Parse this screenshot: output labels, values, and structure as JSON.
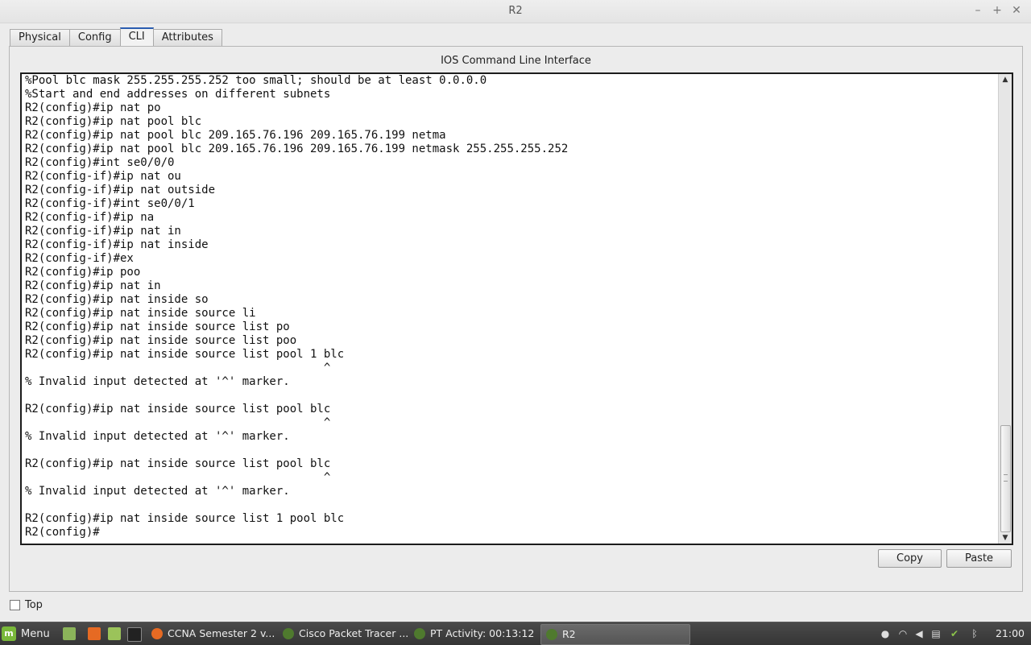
{
  "window": {
    "title": "R2",
    "controls": {
      "minimize": "–",
      "maximize": "+",
      "close": "✕"
    }
  },
  "tabs": [
    {
      "label": "Physical",
      "active": false
    },
    {
      "label": "Config",
      "active": false
    },
    {
      "label": "CLI",
      "active": true
    },
    {
      "label": "Attributes",
      "active": false
    }
  ],
  "cli": {
    "heading": "IOS Command Line Interface",
    "lines": [
      "%Pool blc mask 255.255.255.252 too small; should be at least 0.0.0.0",
      "%Start and end addresses on different subnets",
      "R2(config)#ip nat po",
      "R2(config)#ip nat pool blc",
      "R2(config)#ip nat pool blc 209.165.76.196 209.165.76.199 netma",
      "R2(config)#ip nat pool blc 209.165.76.196 209.165.76.199 netmask 255.255.255.252",
      "R2(config)#int se0/0/0",
      "R2(config-if)#ip nat ou",
      "R2(config-if)#ip nat outside",
      "R2(config-if)#int se0/0/1",
      "R2(config-if)#ip na",
      "R2(config-if)#ip nat in",
      "R2(config-if)#ip nat inside",
      "R2(config-if)#ex",
      "R2(config)#ip poo",
      "R2(config)#ip nat in",
      "R2(config)#ip nat inside so",
      "R2(config)#ip nat inside source li",
      "R2(config)#ip nat inside source list po",
      "R2(config)#ip nat inside source list poo",
      "R2(config)#ip nat inside source list pool 1 blc",
      "                                            ^",
      "% Invalid input detected at '^' marker.",
      "",
      "R2(config)#ip nat inside source list pool blc",
      "                                            ^",
      "% Invalid input detected at '^' marker.",
      "",
      "R2(config)#ip nat inside source list pool blc",
      "                                            ^",
      "% Invalid input detected at '^' marker.",
      "",
      "R2(config)#ip nat inside source list 1 pool blc",
      "R2(config)#"
    ],
    "copy_label": "Copy",
    "paste_label": "Paste"
  },
  "top_checkbox": {
    "label": "Top",
    "checked": false
  },
  "taskbar": {
    "menu_label": "Menu",
    "tasks": [
      {
        "label": "CCNA Semester 2 v...",
        "icon": "firefox-icon",
        "active": false
      },
      {
        "label": "Cisco Packet Tracer ...",
        "icon": "packet-tracer-icon",
        "active": false
      },
      {
        "label": "PT Activity: 00:13:12",
        "icon": "packet-tracer-icon",
        "active": false
      },
      {
        "label": "R2",
        "icon": "packet-tracer-icon",
        "active": true
      }
    ],
    "clock": "21:00",
    "tray_icons": [
      "user-icon",
      "wifi-icon",
      "volume-icon",
      "clipboard-icon",
      "shield-icon",
      "bluetooth-icon"
    ]
  },
  "colors": {
    "accent": "#2a5db0",
    "mint_green": "#79b83a",
    "taskbar_bg": "#3d3d3d",
    "console_bg": "#ffffff"
  }
}
